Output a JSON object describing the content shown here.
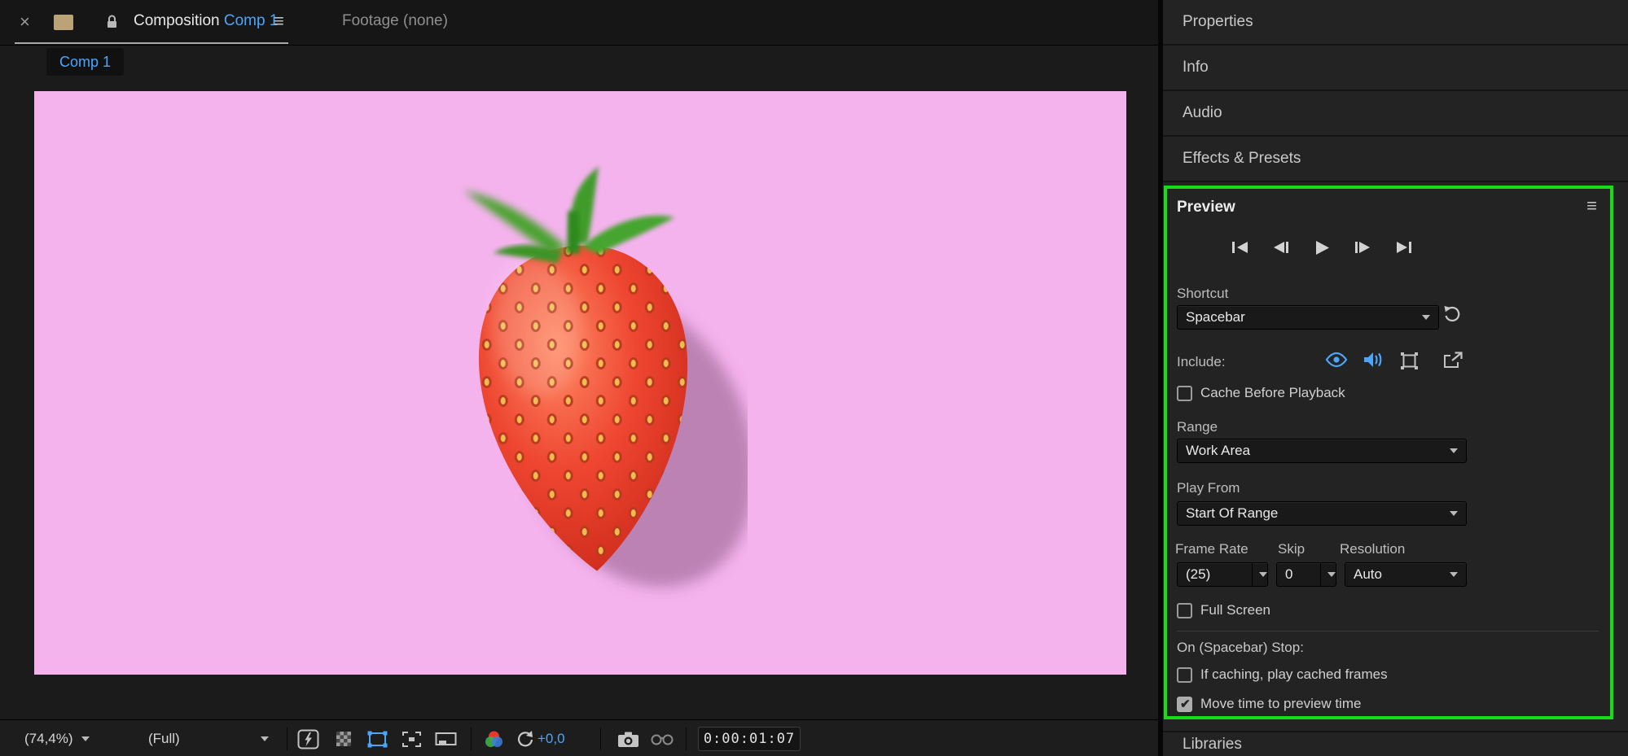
{
  "colors": {
    "accent": "#4ca5f9",
    "highlight_green": "#17dd17",
    "canvas_pink": "#f5b3ee"
  },
  "icons": {
    "close": "×",
    "menu": "≡"
  },
  "tabs": {
    "composition": {
      "label": "Composition",
      "comp": "Comp 1"
    },
    "footage": "Footage (none)",
    "crumb": "Comp 1"
  },
  "toolbar": {
    "zoom": "(74,4%)",
    "resolution": "(Full)",
    "exposure": "+0,0",
    "timecode": "0:00:01:07"
  },
  "sidebar": {
    "rows": [
      "Properties",
      "Info",
      "Audio",
      "Effects & Presets"
    ],
    "bottom_row": "Libraries"
  },
  "preview": {
    "title": "Preview",
    "shortcut_label": "Shortcut",
    "shortcut_value": "Spacebar",
    "include_label": "Include:",
    "cache_label": "Cache Before Playback",
    "range_label": "Range",
    "range_value": "Work Area",
    "play_from_label": "Play From",
    "play_from_value": "Start Of Range",
    "frame_rate_label": "Frame Rate",
    "skip_label": "Skip",
    "resolution_label": "Resolution",
    "frame_rate_value": "(25)",
    "skip_value": "0",
    "resolution_value": "Auto",
    "full_screen_label": "Full Screen",
    "on_stop_label": "On (Spacebar) Stop:",
    "if_caching_label": "If caching, play cached frames",
    "move_time_label": "Move time to preview time",
    "states": {
      "cache_before_playback": false,
      "full_screen": false,
      "if_caching": false,
      "move_time": true
    }
  }
}
